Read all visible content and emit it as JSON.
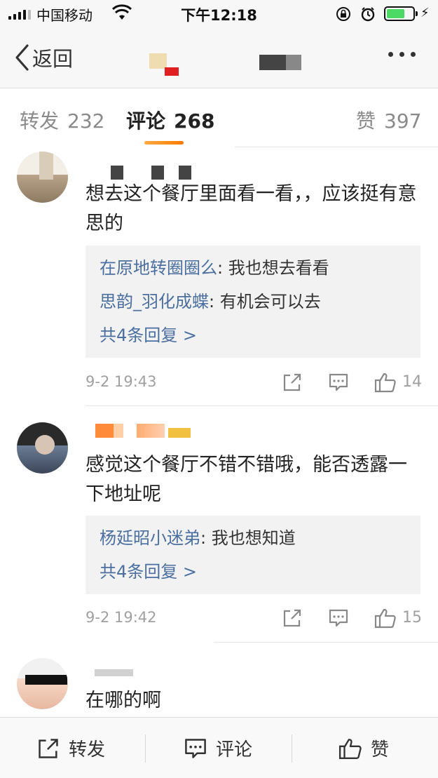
{
  "status_bar": {
    "carrier": "中国移动",
    "time": "下午12:18",
    "battery_level": 0.7,
    "battery_color": "#4cd964"
  },
  "nav": {
    "back_label": "返回",
    "more_icon": "more-dots-icon"
  },
  "tabs": [
    {
      "label": "转发",
      "count": "232",
      "active": false
    },
    {
      "label": "评论",
      "count": "268",
      "active": true
    },
    {
      "label": "赞",
      "count": "397",
      "active": false
    }
  ],
  "comments": [
    {
      "text": "想去这个餐厅里面看一看，，应该挺有意思的",
      "replies": [
        {
          "name": "在原地转圈圈么",
          "text": ": 我也想去看看"
        },
        {
          "name": "思韵_羽化成蝶",
          "text": ": 有机会可以去"
        }
      ],
      "more_replies": "共4条回复 >",
      "timestamp": "9-2 19:43",
      "likes": "14"
    },
    {
      "text": "感觉这个餐厅不错不错哦，能否透露一下地址呢",
      "replies": [
        {
          "name": "杨延昭小迷弟",
          "text": ": 我也想知道"
        }
      ],
      "more_replies": "共4条回复 >",
      "timestamp": "9-2 19:42",
      "likes": "15"
    },
    {
      "text": "在哪的啊"
    }
  ],
  "toolbar": {
    "repost_label": "转发",
    "comment_label": "评论",
    "like_label": "赞"
  },
  "colors": {
    "link": "#4a6fa0",
    "accent": "#ff7a00",
    "muted": "#a0a0a0"
  }
}
